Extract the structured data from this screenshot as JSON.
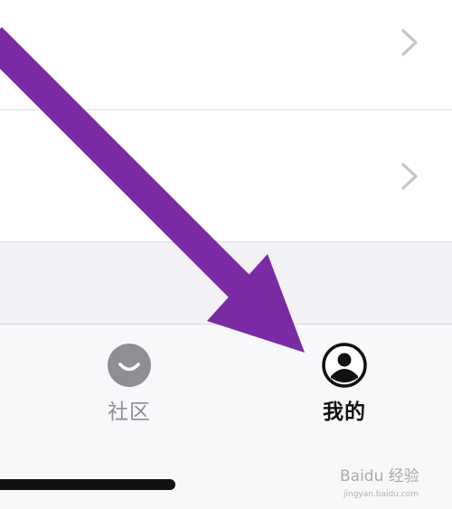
{
  "tab_bar": {
    "tabs": [
      {
        "label": "社区",
        "icon": "community-face-icon",
        "active": false
      },
      {
        "label": "我的",
        "icon": "profile-person-icon",
        "active": true
      }
    ]
  },
  "overlay": {
    "arrow_color": "#7a2ba4",
    "watermark_text": "Baidu 经验",
    "watermark_url": "jingyan.baidu.com"
  },
  "colors": {
    "inactive_tab": "#8e8e93",
    "active_tab": "#111111",
    "chevron": "#c4c4c7",
    "background_band": "#f2f1f6"
  }
}
